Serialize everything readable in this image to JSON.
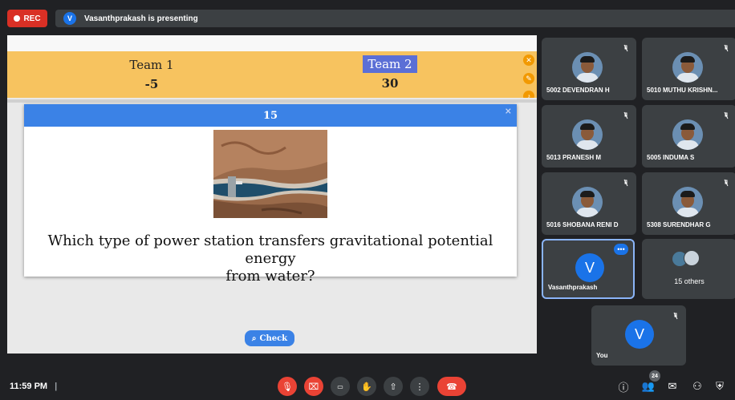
{
  "topbar": {
    "rec_label": "REC",
    "presenter_initial": "V",
    "presenting_text": "Vasanthprakash is presenting"
  },
  "quiz": {
    "team1": {
      "name": "Team 1",
      "score": "-5"
    },
    "team2": {
      "name": "Team 2",
      "score": "30"
    },
    "question_number": "15",
    "close": "×",
    "question_line1": "Which type of power station transfers gravitational potential energy",
    "question_line2": "from water?",
    "check_label": "Check"
  },
  "participants": [
    {
      "name": "5002 DEVENDRAN H"
    },
    {
      "name": "5010 MUTHU KRISHN..."
    },
    {
      "name": "5013 PRANESH M"
    },
    {
      "name": "5005 INDUMA S"
    },
    {
      "name": "5016 SHOBANA RENI D"
    },
    {
      "name": "5308 SURENDHAR G"
    }
  ],
  "presenter_tile": {
    "initial": "V",
    "name": "Vasanthprakash"
  },
  "others_tile": {
    "label": "15 others"
  },
  "self_tile": {
    "initial": "V",
    "name": "You"
  },
  "bottombar": {
    "time": "11:59 PM",
    "separator": "|",
    "people_count": "24"
  },
  "colors": {
    "accent": "#1a73e8",
    "danger": "#ea4335",
    "scorebar": "#f7c35f",
    "quiz_blue": "#3b82e6"
  }
}
